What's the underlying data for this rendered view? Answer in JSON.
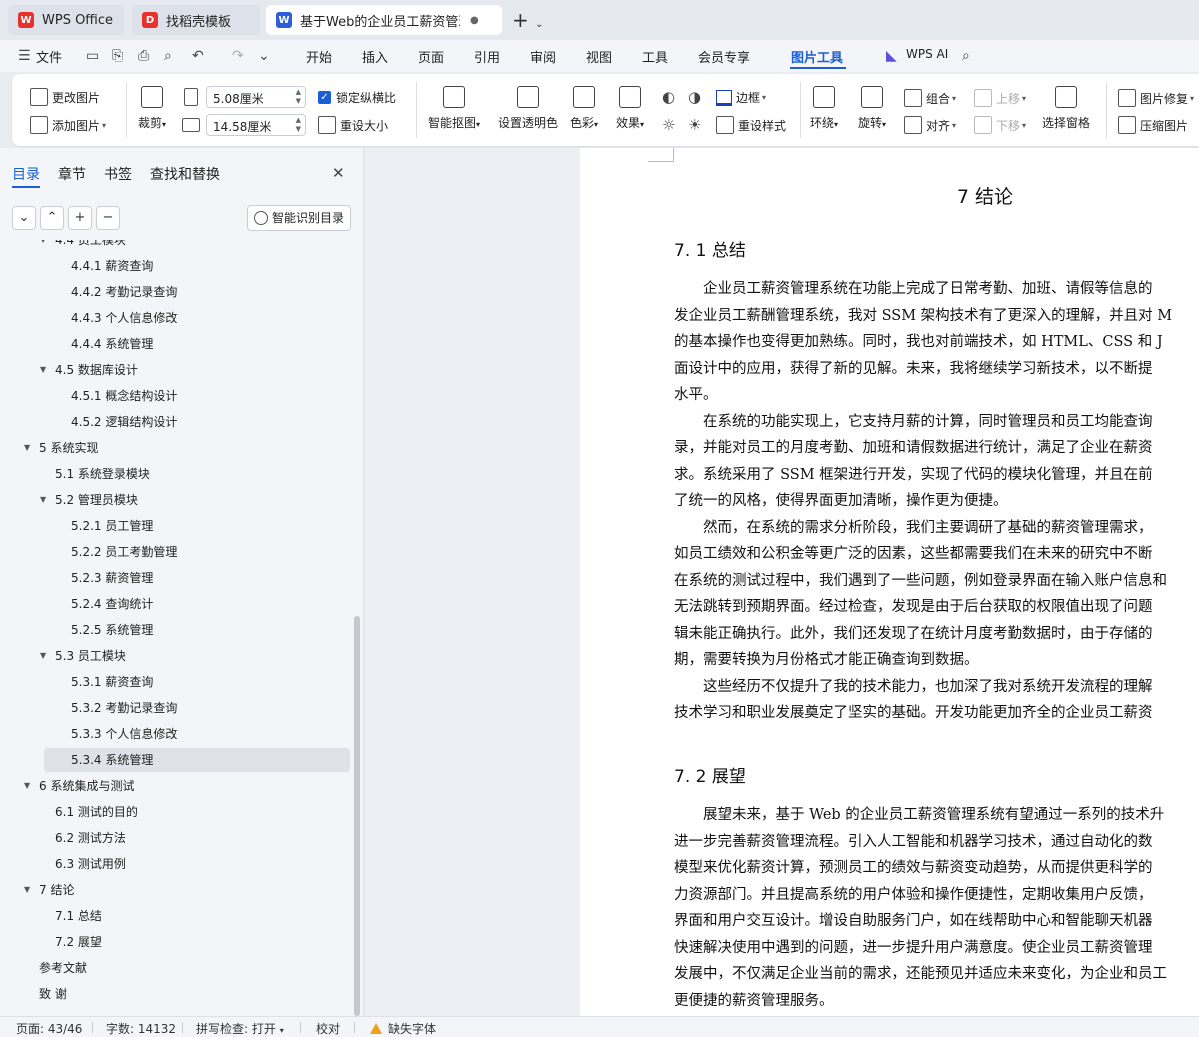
{
  "tabs": [
    {
      "label": "WPS Office",
      "logo": "W",
      "logo_color": "#e8322d"
    },
    {
      "label": "找稻壳模板",
      "logo": "D",
      "logo_color": "#e8322d"
    },
    {
      "label": "基于Web的企业员工薪资管理",
      "logo": "W",
      "logo_color": "#2b5fd9"
    }
  ],
  "menu": {
    "file": "文件",
    "items": [
      "开始",
      "插入",
      "页面",
      "引用",
      "审阅",
      "视图",
      "工具",
      "会员专享",
      "图片工具"
    ],
    "active": "图片工具",
    "ai": "WPS AI"
  },
  "ribbon": {
    "change_image": "更改图片",
    "add_image": "添加图片",
    "crop": "裁剪",
    "width_value": "5.08厘米",
    "height_value": "14.58厘米",
    "lock_ratio": "锁定纵横比",
    "reset_size": "重设大小",
    "smart_cutout": "智能抠图",
    "set_transparent": "设置透明色",
    "color": "色彩",
    "effect": "效果",
    "border": "边框",
    "reset_style": "重设样式",
    "wrap": "环绕",
    "rotate": "旋转",
    "group": "组合",
    "align": "对齐",
    "move_up": "上移",
    "move_down": "下移",
    "selection_pane": "选择窗格",
    "image_repair": "图片修复",
    "compress": "压缩图片"
  },
  "sidebar": {
    "tabs": [
      "目录",
      "章节",
      "书签",
      "查找和替换"
    ],
    "smart_toc": "智能识别目录",
    "toc": [
      {
        "label": "4.4  员工模块",
        "level": 2,
        "expanded": true,
        "partial": true
      },
      {
        "label": "4.4.1  薪资查询",
        "level": 3
      },
      {
        "label": "4.4.2  考勤记录查询",
        "level": 3
      },
      {
        "label": "4.4.3  个人信息修改",
        "level": 3
      },
      {
        "label": "4.4.4  系统管理",
        "level": 3
      },
      {
        "label": "4.5 数据库设计",
        "level": 2,
        "expanded": true
      },
      {
        "label": "4.5.1  概念结构设计",
        "level": 3
      },
      {
        "label": "4.5.2  逻辑结构设计",
        "level": 3
      },
      {
        "label": "5 系统实现",
        "level": 1,
        "expanded": true
      },
      {
        "label": "5.1  系统登录模块",
        "level": 2
      },
      {
        "label": "5.2  管理员模块",
        "level": 2,
        "expanded": true
      },
      {
        "label": "5.2.1  员工管理",
        "level": 3
      },
      {
        "label": "5.2.2  员工考勤管理",
        "level": 3
      },
      {
        "label": "5.2.3  薪资管理",
        "level": 3
      },
      {
        "label": "5.2.4  查询统计",
        "level": 3
      },
      {
        "label": "5.2.5  系统管理",
        "level": 3
      },
      {
        "label": "5.3  员工模块",
        "level": 2,
        "expanded": true
      },
      {
        "label": "5.3.1  薪资查询",
        "level": 3
      },
      {
        "label": "5.3.2  考勤记录查询",
        "level": 3
      },
      {
        "label": "5.3.3  个人信息修改",
        "level": 3
      },
      {
        "label": "5.3.4  系统管理",
        "level": 3,
        "selected": true
      },
      {
        "label": "6 系统集成与测试",
        "level": 1,
        "expanded": true
      },
      {
        "label": "6.1  测试的目的",
        "level": 2
      },
      {
        "label": "6.2  测试方法",
        "level": 2
      },
      {
        "label": "6.3  测试用例",
        "level": 2
      },
      {
        "label": "7 结论",
        "level": 1,
        "expanded": true
      },
      {
        "label": "7.1 总结",
        "level": 2
      },
      {
        "label": "7.2 展望",
        "level": 2
      },
      {
        "label": "参考文献",
        "level": 1
      },
      {
        "label": "致 谢",
        "level": 1
      }
    ]
  },
  "document": {
    "chapter_title": "7 结论",
    "section1_title": "7. 1 总结",
    "section1_paragraphs": [
      [
        "　　企业员工薪资管理系统在功能上完成了日常考勤、加班、请假等信息的",
        "发企业员工薪酬管理系统，我对 SSM 架构技术有了更深入的理解，并且对 M",
        "的基本操作也变得更加熟练。同时，我也对前端技术，如 HTML、CSS 和 J",
        "面设计中的应用，获得了新的见解。未来，我将继续学习新技术，以不断提",
        "水平。"
      ],
      [
        "　　在系统的功能实现上，它支持月薪的计算，同时管理员和员工均能查询",
        "录，并能对员工的月度考勤、加班和请假数据进行统计，满足了企业在薪资",
        "求。系统采用了 SSM 框架进行开发，实现了代码的模块化管理，并且在前",
        "了统一的风格，使得界面更加清晰，操作更为便捷。"
      ],
      [
        "　　然而，在系统的需求分析阶段，我们主要调研了基础的薪资管理需求，",
        "如员工绩效和公积金等更广泛的因素，这些都需要我们在未来的研究中不断",
        "在系统的测试过程中，我们遇到了一些问题，例如登录界面在输入账户信息和",
        "无法跳转到预期界面。经过检查，发现是由于后台获取的权限值出现了问题",
        "辑未能正确执行。此外，我们还发现了在统计月度考勤数据时，由于存储的",
        "期，需要转换为月份格式才能正确查询到数据。"
      ],
      [
        "　　这些经历不仅提升了我的技术能力，也加深了我对系统开发流程的理解",
        "技术学习和职业发展奠定了坚实的基础。开发功能更加齐全的企业员工薪资"
      ]
    ],
    "section2_title": "7. 2 展望",
    "section2_paragraph": [
      "　　展望未来，基于 Web 的企业员工薪资管理系统有望通过一系列的技术升",
      "进一步完善薪资管理流程。引入人工智能和机器学习技术，通过自动化的数",
      "模型来优化薪资计算，预测员工的绩效与薪资变动趋势，从而提供更科学的",
      "力资源部门。并且提高系统的用户体验和操作便捷性，定期收集用户反馈，",
      "界面和用户交互设计。增设自助服务门户，如在线帮助中心和智能聊天机器",
      "快速解决使用中遇到的问题，进一步提升用户满意度。使企业员工薪资管理",
      "发展中，不仅满足企业当前的需求，还能预见并适应未来变化，为企业和员工",
      "更便捷的薪资管理服务。"
    ]
  },
  "status": {
    "page": "页面: 43/46",
    "words": "字数: 14132",
    "spell": "拼写检查: 打开",
    "proof": "校对",
    "missing_font": "缺失字体"
  },
  "colors": {
    "accent": "#1a5fd8",
    "warning": "#f0a020"
  }
}
